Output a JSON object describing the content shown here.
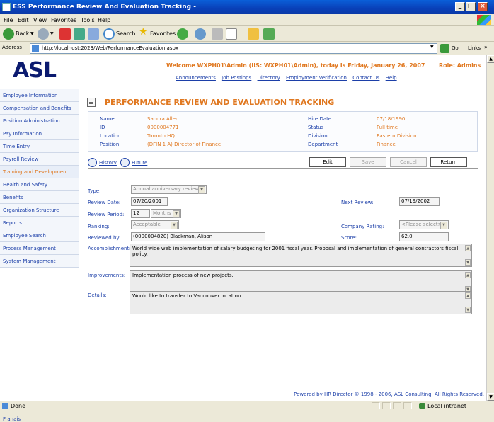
{
  "window": {
    "title": "ESS Performance Review And Evaluation Tracking -"
  },
  "menu": [
    "File",
    "Edit",
    "View",
    "Favorites",
    "Tools",
    "Help"
  ],
  "toolbar": {
    "back": "Back",
    "search": "Search",
    "favorites": "Favorites",
    "go": "Go",
    "links": "Links"
  },
  "address": {
    "label": "Address",
    "url": "http://localhost:2023/Web/PerformanceEvaluation.aspx"
  },
  "header": {
    "logo": "ASL",
    "welcome": "Welcome WXPH01\\Admin (IIS: WXPH01\\Admin), today is Friday, January 26, 2007",
    "role": "Role: Admins",
    "links": [
      "Announcements",
      "Job Postings",
      "Directory",
      "Employment Verification",
      "Contact Us",
      "Help"
    ]
  },
  "nav": {
    "items": [
      "Employee Information",
      "Compensation and Benefits",
      "Position Administration",
      "Pay Information",
      "Time Entry",
      "Payroll Review",
      "Training and Development",
      "Health and Safety",
      "Benefits",
      "Organization Structure",
      "Reports",
      "Employee Search",
      "Process Management",
      "System Management"
    ],
    "active_index": 6,
    "lang": "Franais"
  },
  "page": {
    "title": "PERFORMANCE REVIEW AND EVALUATION TRACKING"
  },
  "employee": {
    "name_label": "Name",
    "name": "Sandra Allen",
    "id_label": "ID",
    "id": "0000004771",
    "location_label": "Location",
    "location": "Toronto HQ",
    "position_label": "Position",
    "position": "(DFIN 1 A) Director of Finance",
    "hire_label": "Hire Date",
    "hire": "07/18/1990",
    "status_label": "Status",
    "status": "Full time",
    "division_label": "Division",
    "division": "Eastern Division",
    "department_label": "Department",
    "department": "Finance"
  },
  "actions": {
    "history": "History",
    "future": "Future",
    "edit": "Edit",
    "save": "Save",
    "cancel": "Cancel",
    "return": "Return"
  },
  "form": {
    "type_label": "Type:",
    "type": "Annual anniversary review",
    "review_date_label": "Review Date:",
    "review_date": "07/20/2001",
    "next_review_label": "Next Review:",
    "next_review": "07/19/2002",
    "period_label": "Review Period:",
    "period": "12",
    "period_unit": "Months",
    "ranking_label": "Ranking:",
    "ranking": "Acceptable",
    "company_rating_label": "Company Rating:",
    "company_rating": "<Please select>",
    "reviewed_by_label": "Reviewed by:",
    "reviewed_by": "(0000004820) Blackman, Alison",
    "score_label": "Score:",
    "score": "62.0",
    "accomplishments_label": "Accomplishments:",
    "accomplishments": "World wide web implementation of salary budgeting for 2001 fiscal year.  Proposal and implementation of general contractors fiscal policy.",
    "improvements_label": "Improvements:",
    "improvements": "Implementation process of new projects.",
    "details_label": "Details:",
    "details": "Would like to transfer to Vancouver location."
  },
  "footer": {
    "text": "Powered by HR Director © 1998 - 2006,",
    "link": "ASL Consulting.",
    "rights": "All Rights Reserved."
  },
  "status": {
    "left": "Done",
    "right": "Local intranet"
  }
}
